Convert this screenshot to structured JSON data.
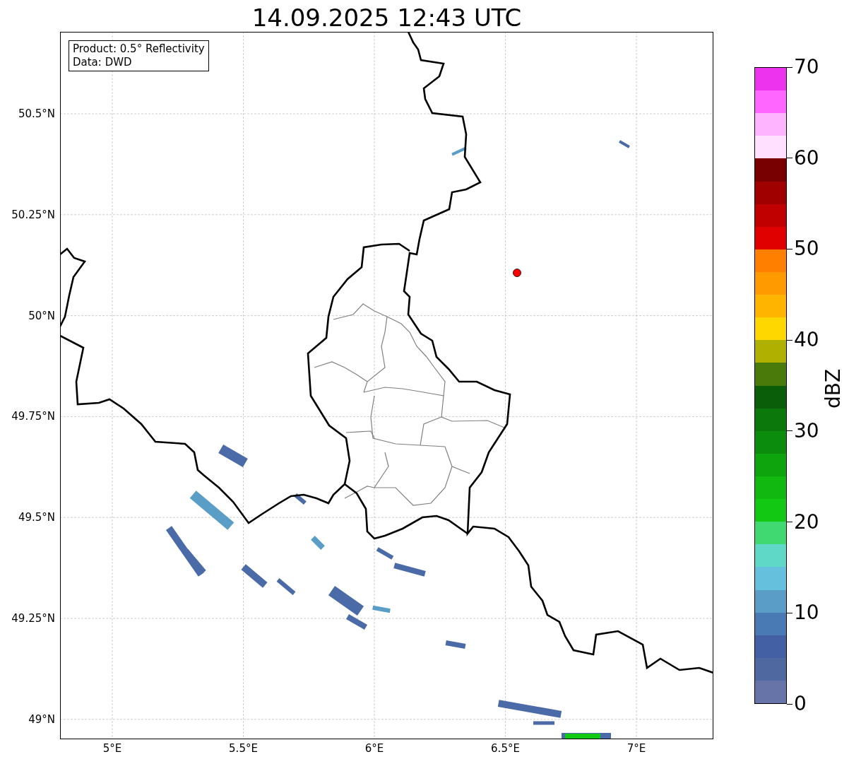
{
  "title": "14.09.2025 12:43 UTC",
  "info_box": {
    "lines": [
      "Product: 0.5° Reflectivity",
      "Data: DWD"
    ]
  },
  "lat_ticks": [
    "50.5°N",
    "50.25°N",
    "50°N",
    "49.75°N",
    "49.5°N",
    "49.25°N",
    "49°N"
  ],
  "lon_ticks": [
    "5°E",
    "5.5°E",
    "6°E",
    "6.5°E",
    "7°E"
  ],
  "colorbar": {
    "label": "dBZ",
    "ticks": [
      "70",
      "60",
      "50",
      "40",
      "30",
      "20",
      "10",
      "0"
    ],
    "bins": [
      {
        "color": "#ee33ee"
      },
      {
        "color": "#ff66ff"
      },
      {
        "color": "#ffb4ff"
      },
      {
        "color": "#ffe0ff"
      },
      {
        "color": "#780000"
      },
      {
        "color": "#a00000"
      },
      {
        "color": "#c00000"
      },
      {
        "color": "#e00000"
      },
      {
        "color": "#ff7f00"
      },
      {
        "color": "#ff9a00"
      },
      {
        "color": "#ffb400"
      },
      {
        "color": "#ffd700"
      },
      {
        "color": "#b0b000"
      },
      {
        "color": "#4a7a0a"
      },
      {
        "color": "#0a5e0a"
      },
      {
        "color": "#0a780a"
      },
      {
        "color": "#0c8c0c"
      },
      {
        "color": "#0ea40e"
      },
      {
        "color": "#10b810"
      },
      {
        "color": "#12c812"
      },
      {
        "color": "#40d870"
      },
      {
        "color": "#60d8c8"
      },
      {
        "color": "#64c0dc"
      },
      {
        "color": "#5a9ec8"
      },
      {
        "color": "#4a7ab4"
      },
      {
        "color": "#4460a4"
      },
      {
        "color": "#5068a0"
      },
      {
        "color": "#6674a8"
      }
    ]
  }
}
